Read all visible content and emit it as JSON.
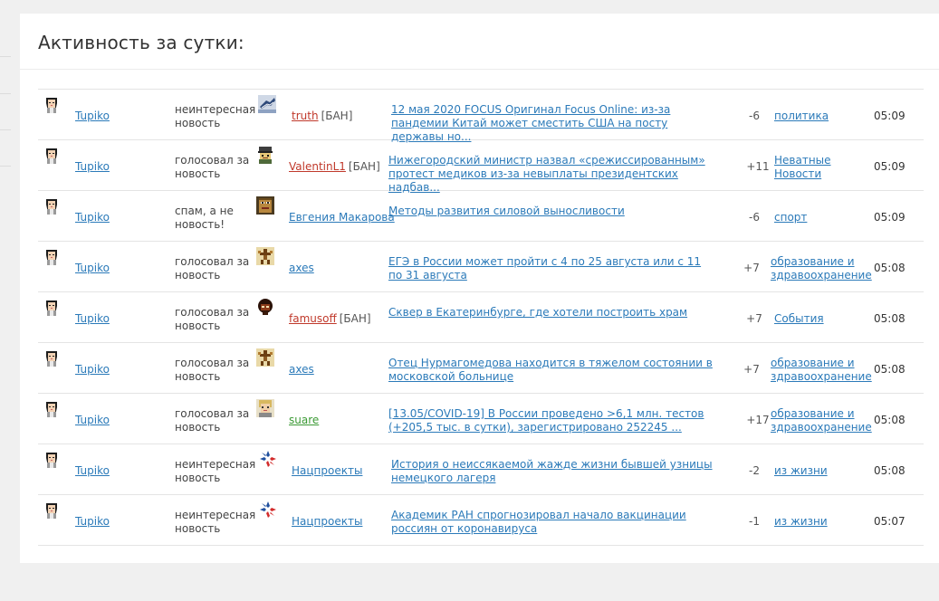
{
  "title": "Активность за сутки:",
  "rows": [
    {
      "actor": "Tupiko",
      "action": "неинтересная новость",
      "author": "truth",
      "author_style": "ban",
      "banned": true,
      "news": "12 мая 2020 FOCUS Оригинал Focus Online: из-за пандемии Китай может сместить США на посту державы но...",
      "score": "-6",
      "category": "политика",
      "time": "05:09",
      "author_icon": "hand-picture-avatar-icon"
    },
    {
      "actor": "Tupiko",
      "action": "голосовал за новость",
      "author": "ValentinL1",
      "author_style": "ban",
      "banned": true,
      "news": "Нижегородский министр назвал «срежиссированным» протест медиков из-за невыплаты президентских надбав...",
      "score": "+11",
      "category": "Неватные Новости",
      "time": "05:09",
      "author_icon": "pixel-soldier-avatar-icon"
    },
    {
      "actor": "Tupiko",
      "action": "спам, а не новость!",
      "author": "Евгения Макарова",
      "author_style": "normal",
      "banned": false,
      "news": "Методы развития силовой выносливости",
      "score": "-6",
      "category": "спорт",
      "time": "05:09",
      "author_icon": "pixel-face-avatar-icon"
    },
    {
      "actor": "Tupiko",
      "action": "голосовал за новость",
      "author": "axes",
      "author_style": "normal",
      "banned": false,
      "news": "ЕГЭ в России может пройти с 4 по 25 августа или с 11 по 31 августа",
      "score": "+7",
      "category": "образование и здравоохранение",
      "time": "05:08",
      "author_icon": "pixel-figure-avatar-icon"
    },
    {
      "actor": "Tupiko",
      "action": "голосовал за новость",
      "author": "famusoff",
      "author_style": "ban",
      "banned": true,
      "news": "Сквер в Екатеринбурге, где хотели построить храм",
      "score": "+7",
      "category": "События",
      "time": "05:08",
      "author_icon": "pixel-dark-avatar-icon"
    },
    {
      "actor": "Tupiko",
      "action": "голосовал за новость",
      "author": "axes",
      "author_style": "normal",
      "banned": false,
      "news": "Отец Нурмагомедова находится в тяжелом состоянии в московской больнице",
      "score": "+7",
      "category": "образование и здравоохранение",
      "time": "05:08",
      "author_icon": "pixel-figure-avatar-icon"
    },
    {
      "actor": "Tupiko",
      "action": "голосовал за новость",
      "author": "suare",
      "author_style": "green",
      "banned": false,
      "news": "[13.05/COVID-19] В России проведено >6,1 млн. тестов (+205,5 тыс. в сутки), зарегистрировано 252245 ...",
      "score": "+17",
      "category": "образование и здравоохранение",
      "time": "05:08",
      "author_icon": "pixel-blonde-avatar-icon"
    },
    {
      "actor": "Tupiko",
      "action": "неинтересная новость",
      "author": "Нацпроекты",
      "author_style": "normal",
      "banned": false,
      "news": "История о неиссякаемой жажде жизни бывшей узницы немецкого лагеря",
      "score": "-2",
      "category": "из жизни",
      "time": "05:08",
      "author_icon": "natsproekty-logo-icon"
    },
    {
      "actor": "Tupiko",
      "action": "неинтересная новость",
      "author": "Нацпроекты",
      "author_style": "normal",
      "banned": false,
      "news": "Академик РАН спрогнозировал начало вакцинации россиян от коронавируса",
      "score": "-1",
      "category": "из жизни",
      "time": "05:07",
      "author_icon": "natsproekty-logo-icon"
    }
  ],
  "ban_label": "[БАН]",
  "colors": {
    "link": "#2b7ab9",
    "ban": "#c0392b",
    "green": "#3c9a35",
    "background": "#f0f0f0",
    "panel": "#ffffff"
  }
}
